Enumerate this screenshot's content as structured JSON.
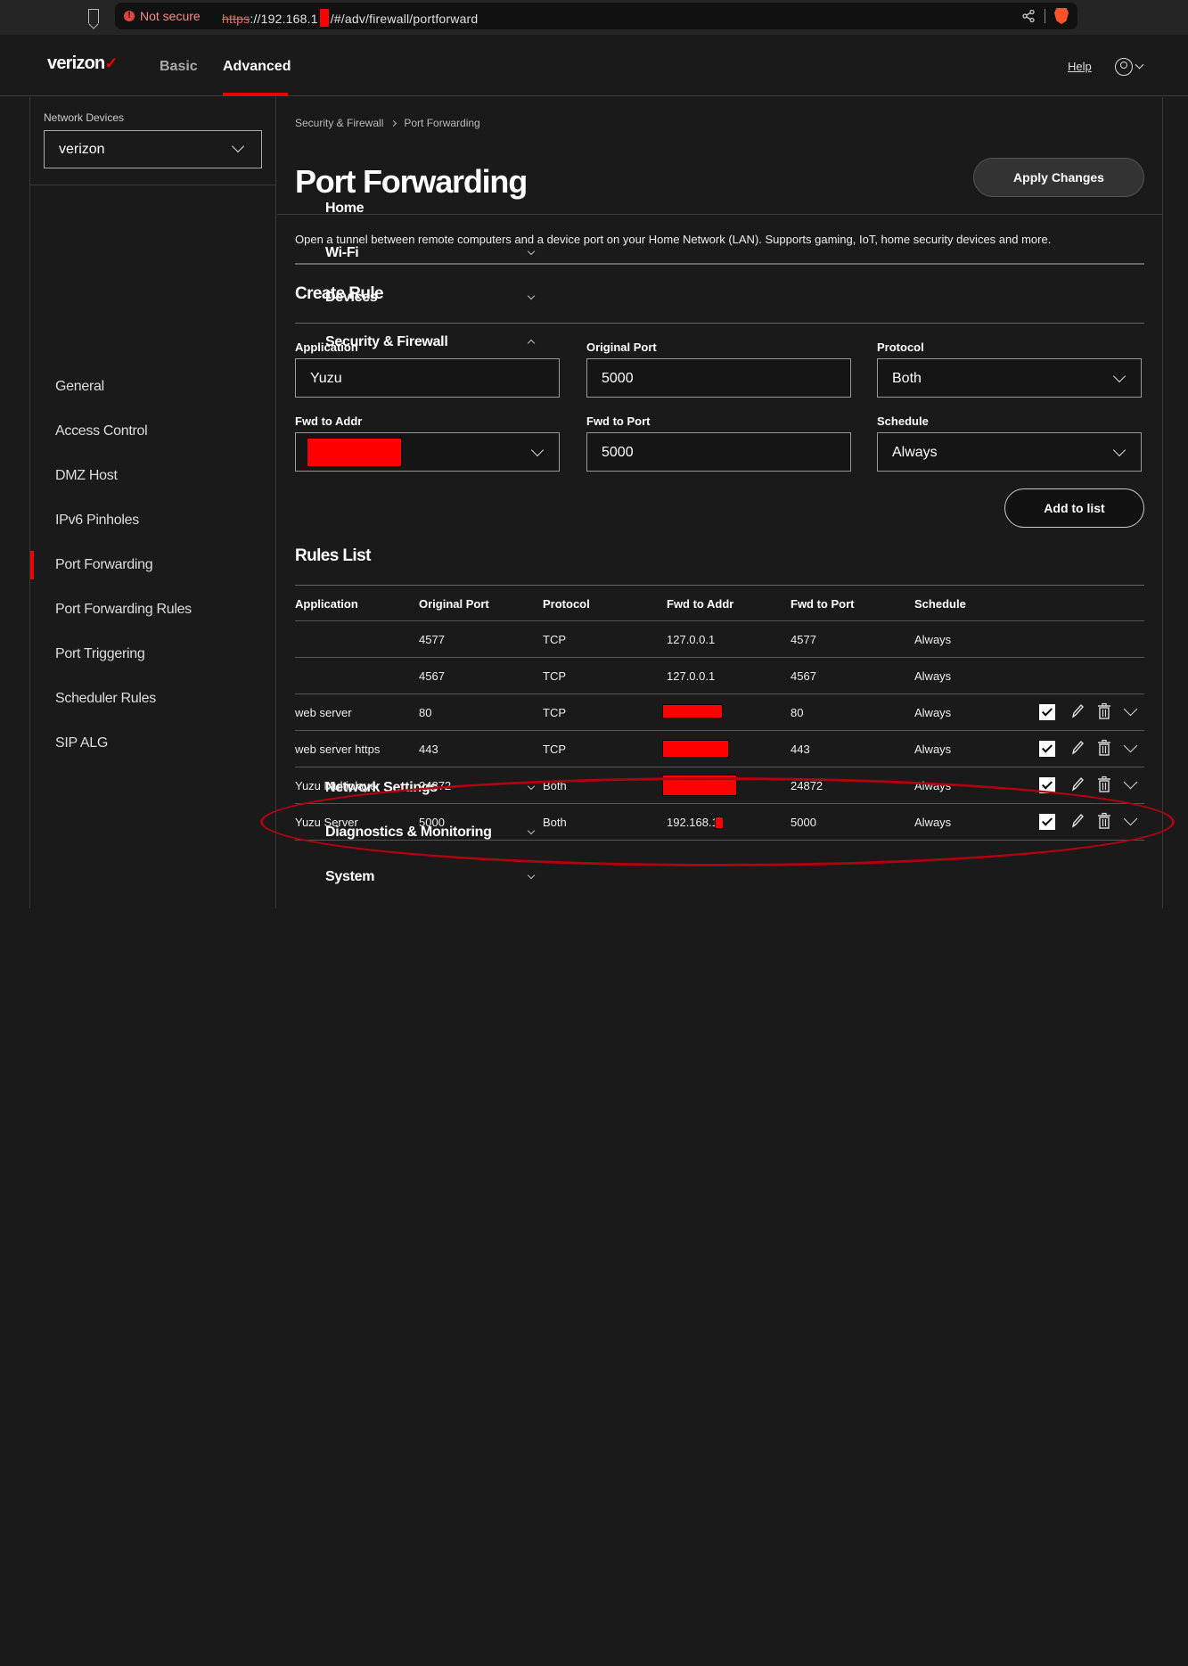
{
  "browser": {
    "security_label": "Not secure",
    "url_scheme": "https",
    "url_host": "://192.168.1",
    "url_path": "/#/adv/firewall/portforward"
  },
  "header": {
    "logo": "verizon",
    "logo_mark": "✓",
    "tabs": [
      {
        "label": "Basic"
      },
      {
        "label": "Advanced"
      }
    ],
    "help": "Help"
  },
  "sidebar": {
    "network_devices_label": "Network Devices",
    "network_device_value": "verizon",
    "items": [
      {
        "label": "Home"
      },
      {
        "label": "Wi-Fi"
      },
      {
        "label": "Devices"
      },
      {
        "label": "Security & Firewall"
      },
      {
        "label": "General"
      },
      {
        "label": "Access Control"
      },
      {
        "label": "DMZ Host"
      },
      {
        "label": "IPv6 Pinholes"
      },
      {
        "label": "Port Forwarding"
      },
      {
        "label": "Port Forwarding Rules"
      },
      {
        "label": "Port Triggering"
      },
      {
        "label": "Scheduler Rules"
      },
      {
        "label": "SIP ALG"
      },
      {
        "label": "Network Settings"
      },
      {
        "label": "Diagnostics & Monitoring"
      },
      {
        "label": "System"
      }
    ]
  },
  "main": {
    "breadcrumb": [
      "Security & Firewall",
      "Port Forwarding"
    ],
    "title": "Port Forwarding",
    "apply_label": "Apply Changes",
    "description": "Open a tunnel between remote computers and a device port on your Home Network (LAN). Supports gaming, IoT, home security devices and more.",
    "create_rule": {
      "heading": "Create Rule",
      "application_label": "Application",
      "application_value": "Yuzu",
      "original_port_label": "Original Port",
      "original_port_value": "5000",
      "protocol_label": "Protocol",
      "protocol_value": "Both",
      "fwd_addr_label": "Fwd to Addr",
      "fwd_port_label": "Fwd to Port",
      "fwd_port_value": "5000",
      "schedule_label": "Schedule",
      "schedule_value": "Always",
      "add_label": "Add to list"
    },
    "rules_list": {
      "heading": "Rules List",
      "columns": [
        "Application",
        "Original Port",
        "Protocol",
        "Fwd to Addr",
        "Fwd to Port",
        "Schedule"
      ],
      "rows": [
        {
          "application": "",
          "original_port": "4577",
          "protocol": "TCP",
          "fwd_addr": "127.0.0.1",
          "fwd_port": "4577",
          "schedule": "Always"
        },
        {
          "application": "",
          "original_port": "4567",
          "protocol": "TCP",
          "fwd_addr": "127.0.0.1",
          "fwd_port": "4567",
          "schedule": "Always"
        },
        {
          "application": "web server",
          "original_port": "80",
          "protocol": "TCP",
          "fwd_addr": "",
          "fwd_port": "80",
          "schedule": "Always"
        },
        {
          "application": "web server https",
          "original_port": "443",
          "protocol": "TCP",
          "fwd_addr": "",
          "fwd_port": "443",
          "schedule": "Always"
        },
        {
          "application": "Yuzu Multiplayer",
          "original_port": "24872",
          "protocol": "Both",
          "fwd_addr": "",
          "fwd_port": "24872",
          "schedule": "Always"
        },
        {
          "application": "Yuzu Server",
          "original_port": "5000",
          "protocol": "Both",
          "fwd_addr": "192.168.1.",
          "fwd_port": "5000",
          "schedule": "Always"
        }
      ]
    }
  },
  "colors": {
    "accent": "#ee0000",
    "background": "#1a1a1a",
    "annotation": "#b00010"
  }
}
